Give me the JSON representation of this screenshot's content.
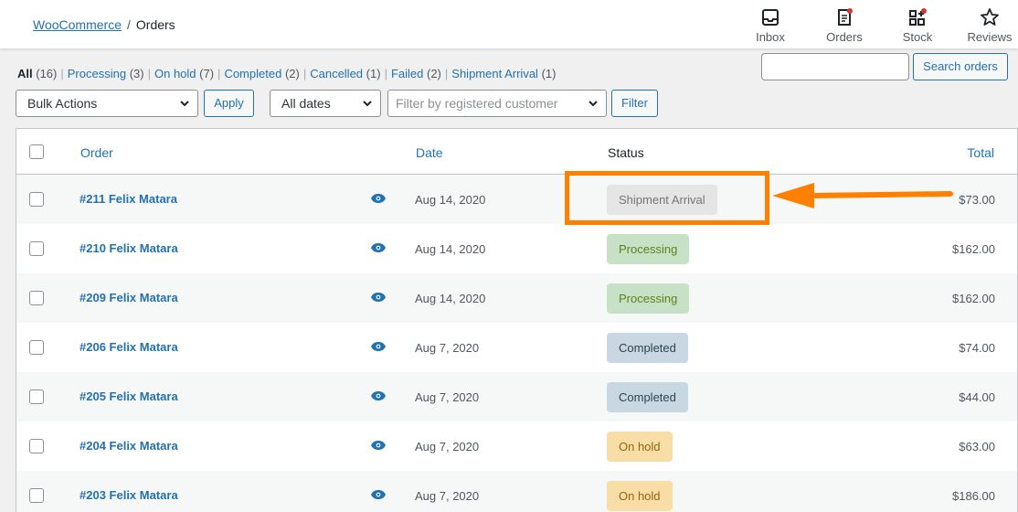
{
  "breadcrumb": {
    "root": "WooCommerce",
    "separator": "/",
    "current": "Orders"
  },
  "topnav": [
    {
      "label": "Inbox",
      "icon": "inbox-icon"
    },
    {
      "label": "Orders",
      "icon": "orders-icon"
    },
    {
      "label": "Stock",
      "icon": "stock-icon"
    },
    {
      "label": "Reviews",
      "icon": "star-icon"
    }
  ],
  "views": [
    {
      "label": "All",
      "count": "(16)"
    },
    {
      "label": "Processing",
      "count": "(3)"
    },
    {
      "label": "On hold",
      "count": "(7)"
    },
    {
      "label": "Completed",
      "count": "(2)"
    },
    {
      "label": "Cancelled",
      "count": "(1)"
    },
    {
      "label": "Failed",
      "count": "(2)"
    },
    {
      "label": "Shipment Arrival",
      "count": "(1)"
    }
  ],
  "search": {
    "placeholder": "",
    "button": "Search orders"
  },
  "filters": {
    "bulk_actions": "Bulk Actions",
    "apply": "Apply",
    "dates": "All dates",
    "customer_placeholder": "Filter by registered customer",
    "filter": "Filter"
  },
  "columns": {
    "order": "Order",
    "date": "Date",
    "status": "Status",
    "total": "Total"
  },
  "orders": [
    {
      "order": "#211 Felix Matara",
      "date": "Aug 14, 2020",
      "status": "Shipment Arrival",
      "total": "$73.00"
    },
    {
      "order": "#210 Felix Matara",
      "date": "Aug 14, 2020",
      "status": "Processing",
      "total": "$162.00"
    },
    {
      "order": "#209 Felix Matara",
      "date": "Aug 14, 2020",
      "status": "Processing",
      "total": "$162.00"
    },
    {
      "order": "#206 Felix Matara",
      "date": "Aug 7, 2020",
      "status": "Completed",
      "total": "$74.00"
    },
    {
      "order": "#205 Felix Matara",
      "date": "Aug 7, 2020",
      "status": "Completed",
      "total": "$44.00"
    },
    {
      "order": "#204 Felix Matara",
      "date": "Aug 7, 2020",
      "status": "On hold",
      "total": "$63.00"
    },
    {
      "order": "#203 Felix Matara",
      "date": "Aug 7, 2020",
      "status": "On hold",
      "total": "$186.00"
    }
  ],
  "colors": {
    "link": "#2271b1",
    "highlight": "#ff7f00",
    "notification_dot": "#d63638"
  }
}
